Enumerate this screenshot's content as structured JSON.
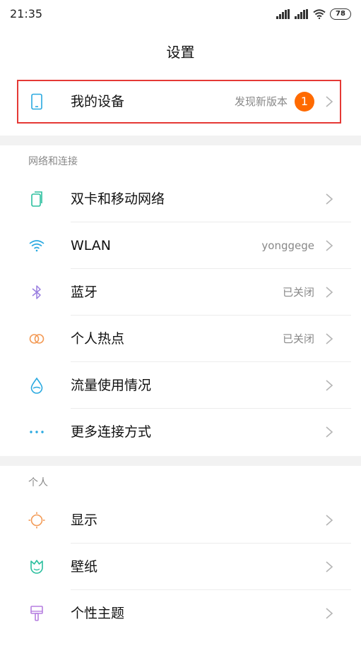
{
  "status": {
    "time": "21:35",
    "battery": "78"
  },
  "title": "设置",
  "device": {
    "label": "我的设备",
    "value": "发现新版本",
    "badge": "1"
  },
  "sections": {
    "network": {
      "header": "网络和连接",
      "items": [
        {
          "label": "双卡和移动网络",
          "value": ""
        },
        {
          "label": "WLAN",
          "value": "yonggege"
        },
        {
          "label": "蓝牙",
          "value": "已关闭"
        },
        {
          "label": "个人热点",
          "value": "已关闭"
        },
        {
          "label": "流量使用情况",
          "value": ""
        },
        {
          "label": "更多连接方式",
          "value": ""
        }
      ]
    },
    "personal": {
      "header": "个人",
      "items": [
        {
          "label": "显示",
          "value": ""
        },
        {
          "label": "壁纸",
          "value": ""
        },
        {
          "label": "个性主题",
          "value": ""
        }
      ]
    }
  },
  "colors": {
    "device_icon": "#29a9e0",
    "sim_icon": "#2bbf9e",
    "wifi_icon": "#29a9e0",
    "bluetooth_icon": "#9a7fe0",
    "hotspot_icon": "#f39a55",
    "data_usage_icon": "#29a9e0",
    "more_icon": "#29a9e0",
    "display_icon": "#f39a55",
    "wallpaper_icon": "#2bbf9e",
    "theme_icon": "#b57ee0",
    "badge": "#ff6a00",
    "highlight": "#e53935"
  }
}
